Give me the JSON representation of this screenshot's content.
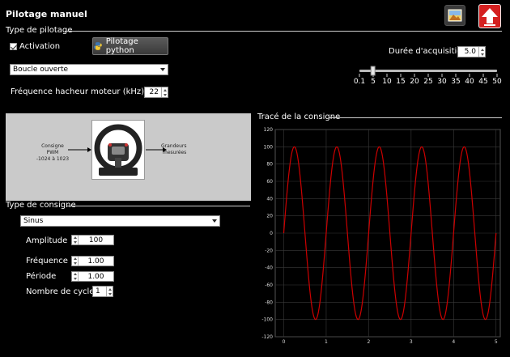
{
  "window": {
    "title": "Pilotage manuel"
  },
  "toolbar": {
    "image_icon": "image-icon",
    "upload_icon": "upload-arrow-icon"
  },
  "type_pilotage": {
    "heading": "Type de pilotage",
    "activation_label": "Activation",
    "activation_checked": true,
    "python_button": "Pilotage python",
    "mode_value": "Boucle ouverte",
    "freq_label": "Fréquence hacheur moteur (kHz)",
    "freq_value": "22"
  },
  "acquisition": {
    "label": "Durée d'acquisition",
    "value": "5.0",
    "slider_min": 0.1,
    "slider_max": 50,
    "slider_value": 5,
    "ticks": [
      "0.1",
      "5",
      "10",
      "15",
      "20",
      "25",
      "30",
      "35",
      "40",
      "45",
      "50"
    ]
  },
  "diagram": {
    "input_label_1": "Consigne",
    "input_label_2": "PWM",
    "input_label_3": "-1024 à 1023",
    "output_label_1": "Grandeurs",
    "output_label_2": "mesurées",
    "wheel_icon": "steering-wheel-icon"
  },
  "consigne": {
    "heading": "Type de consigne",
    "type_value": "Sinus",
    "amplitude_label": "Amplitude",
    "amplitude_value": "100",
    "frequence_label": "Fréquence",
    "frequence_value": "1.00",
    "periode_label": "Période",
    "periode_value": "1.00",
    "cycles_label": "Nombre de cycles",
    "cycles_value": "1"
  },
  "chart": {
    "heading": "Tracé de la consigne",
    "line_color": "#cc0000",
    "grid_color": "#3a3a3a"
  },
  "chart_data": {
    "type": "line",
    "title": "Tracé de la consigne",
    "xlabel": "",
    "ylabel": "",
    "xlim": [
      -0.2,
      5.1
    ],
    "ylim": [
      -120,
      120
    ],
    "xticks": [
      0,
      1,
      2,
      3,
      4,
      5
    ],
    "yticks": [
      120,
      100,
      80,
      60,
      40,
      20,
      0,
      -20,
      -40,
      -60,
      -80,
      -100,
      -120
    ],
    "grid": true,
    "series": [
      {
        "function": "sine",
        "amplitude": 100,
        "frequency": 1,
        "x_start": 0,
        "x_end": 5
      }
    ]
  }
}
